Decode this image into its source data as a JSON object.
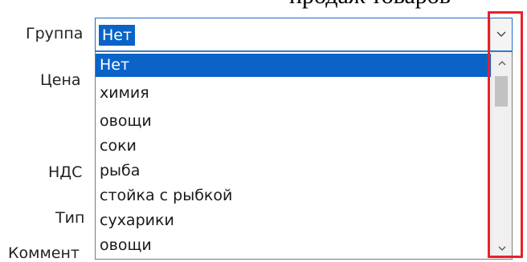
{
  "header_text": "продаж товаров",
  "labels": {
    "group": "Группа",
    "price": "Цена",
    "vat": "НДС",
    "type": "Тип",
    "comment": "Коммент"
  },
  "combo": {
    "selected_value": "Нет"
  },
  "dropdown": {
    "options": [
      "Нет",
      "химия",
      "овощи",
      "соки",
      "рыба",
      "стойка с рыбкой",
      "сухарики",
      "овощи"
    ],
    "selected_index": 0,
    "scroll_position": 0.0
  },
  "colors": {
    "selection": "#0a64c8",
    "highlight": "#e8212a",
    "focus_border": "#1e6ec8"
  },
  "icons": {
    "combo_arrow": "chevron-down-icon",
    "scroll_up": "chevron-up-icon",
    "scroll_down": "chevron-down-icon"
  }
}
